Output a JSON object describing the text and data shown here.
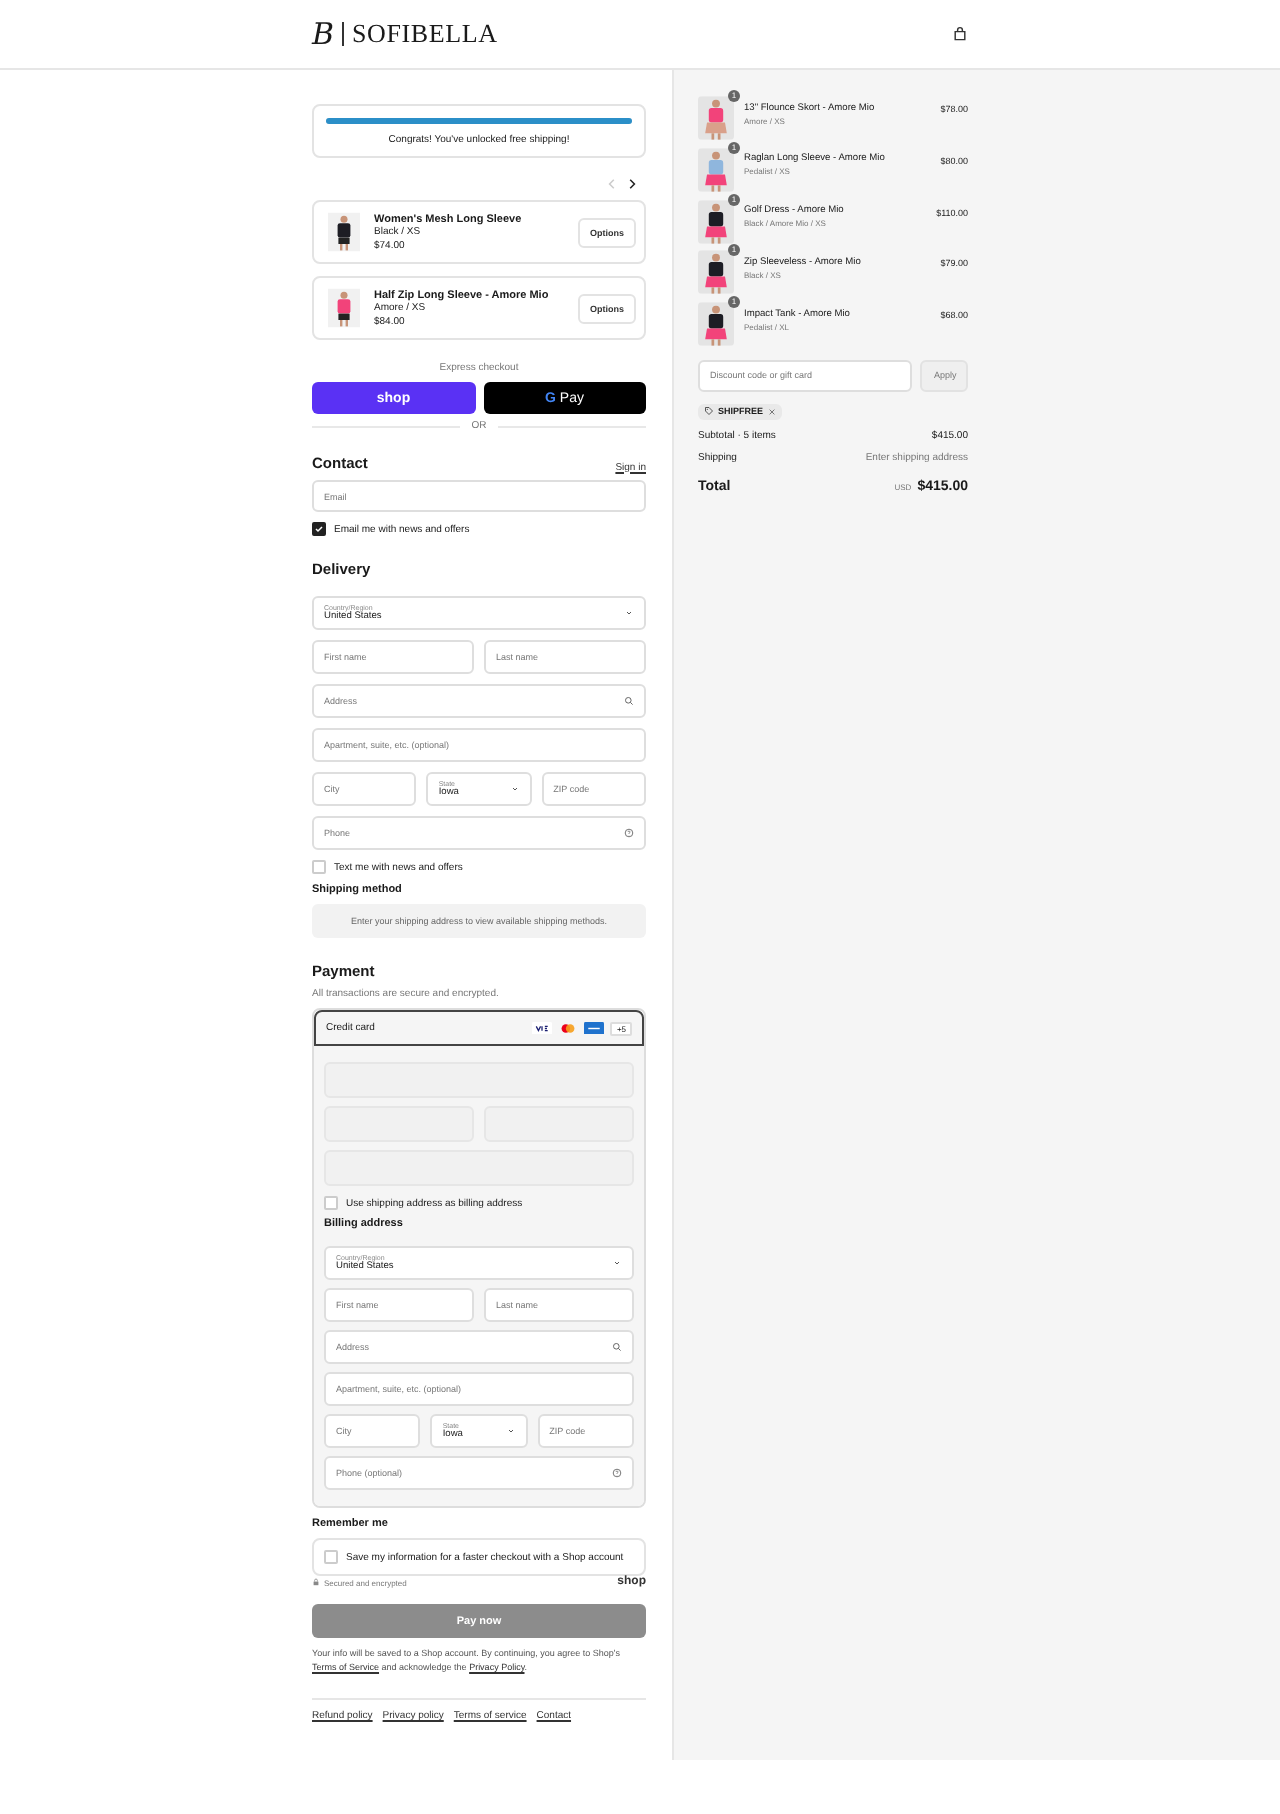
{
  "header": {
    "monogram": "B",
    "brand": "SOFIBELLA"
  },
  "shipping_bar": {
    "level": 1,
    "message": "Congrats! You've unlocked free shipping!"
  },
  "carousel": {
    "prev_disabled": true,
    "next_disabled": false
  },
  "upsells": [
    {
      "name": "Women's Mesh Long Sleeve",
      "variant": "Black / XS",
      "price": "$74.00",
      "button": "Options"
    },
    {
      "name": "Half Zip Long Sleeve - Amore Mio",
      "variant": "Amore / XS",
      "price": "$84.00",
      "button": "Options"
    }
  ],
  "express": {
    "title": "Express checkout",
    "shop": "shop",
    "gpay_mark": "G",
    "gpay": "Pay",
    "or": "OR"
  },
  "contact": {
    "title": "Contact",
    "sign_in": "Sign in",
    "email": {
      "placeholder": "Email"
    },
    "newsletter": {
      "label": "Email me with news and offers",
      "checked": true
    }
  },
  "delivery": {
    "title": "Delivery",
    "rows": [
      [
        {
          "kind": "select",
          "label": "Country/Region",
          "value": "United States"
        }
      ],
      [
        {
          "kind": "text",
          "placeholder": "First name"
        },
        {
          "kind": "text",
          "placeholder": "Last name"
        }
      ],
      [
        {
          "kind": "search",
          "placeholder": "Address"
        }
      ],
      [
        {
          "kind": "text",
          "placeholder": "Apartment, suite, etc. (optional)"
        }
      ],
      [
        {
          "kind": "text",
          "placeholder": "City"
        },
        {
          "kind": "select",
          "label": "State",
          "value": "Iowa"
        },
        {
          "kind": "text",
          "placeholder": "ZIP code"
        }
      ],
      [
        {
          "kind": "help",
          "placeholder": "Phone"
        }
      ]
    ],
    "sms": {
      "label": "Text me with news and offers",
      "checked": false
    }
  },
  "shipping_method": {
    "title": "Shipping method",
    "message": "Enter your shipping address to view available shipping methods."
  },
  "payment": {
    "title": "Payment",
    "subtitle": "All transactions are secure and encrypted.",
    "method": "Credit card",
    "more_cards": "+5",
    "billing_same": {
      "label": "Use shipping address as billing address",
      "checked": false
    },
    "billing_title": "Billing address",
    "rows": [
      [
        {
          "kind": "select",
          "label": "Country/Region",
          "value": "United States"
        }
      ],
      [
        {
          "kind": "text",
          "placeholder": "First name"
        },
        {
          "kind": "text",
          "placeholder": "Last name"
        }
      ],
      [
        {
          "kind": "search",
          "placeholder": "Address"
        }
      ],
      [
        {
          "kind": "text",
          "placeholder": "Apartment, suite, etc. (optional)"
        }
      ],
      [
        {
          "kind": "text",
          "placeholder": "City"
        },
        {
          "kind": "select",
          "label": "State",
          "value": "Iowa"
        },
        {
          "kind": "text",
          "placeholder": "ZIP code"
        }
      ],
      [
        {
          "kind": "help",
          "placeholder": "Phone (optional)"
        }
      ]
    ]
  },
  "remember": {
    "title": "Remember me",
    "save": {
      "label": "Save my information for a faster checkout with a Shop account",
      "checked": false
    },
    "secured": "Secured and encrypted",
    "shop": "shop"
  },
  "pay_button": {
    "label": "Pay now",
    "disabled": true
  },
  "legal": {
    "before": "Your info will be saved to a Shop account. By continuing, you agree to Shop's",
    "link_1": "Terms of Service",
    "middle": "and acknowledge the",
    "link_2": "Privacy Policy",
    "after": "."
  },
  "footer_links": [
    "Refund policy",
    "Privacy policy",
    "Terms of service",
    "Contact"
  ],
  "order": {
    "items": [
      {
        "name": "13\" Flounce Skort - Amore Mio",
        "variant": "Amore / XS",
        "price": "$78.00",
        "quantity": "1"
      },
      {
        "name": "Raglan Long Sleeve - Amore Mio",
        "variant": "Pedalist / XS",
        "price": "$80.00",
        "quantity": "1"
      },
      {
        "name": "Golf Dress - Amore Mio",
        "variant": "Black / Amore Mio / XS",
        "price": "$110.00",
        "quantity": "1"
      },
      {
        "name": "Zip Sleeveless - Amore Mio",
        "variant": "Black / XS",
        "price": "$79.00",
        "quantity": "1"
      },
      {
        "name": "Impact Tank - Amore Mio",
        "variant": "Pedalist / XL",
        "price": "$68.00",
        "quantity": "1"
      }
    ],
    "discount": {
      "placeholder": "Discount code or gift card",
      "button": "Apply"
    },
    "code": "SHIPFREE",
    "subtotal": {
      "label": "Subtotal · 5 items",
      "value": "$415.00"
    },
    "shipping": {
      "label": "Shipping",
      "value": "Enter shipping address"
    },
    "total": {
      "label": "Total",
      "currency": "USD",
      "value": "$415.00"
    }
  }
}
